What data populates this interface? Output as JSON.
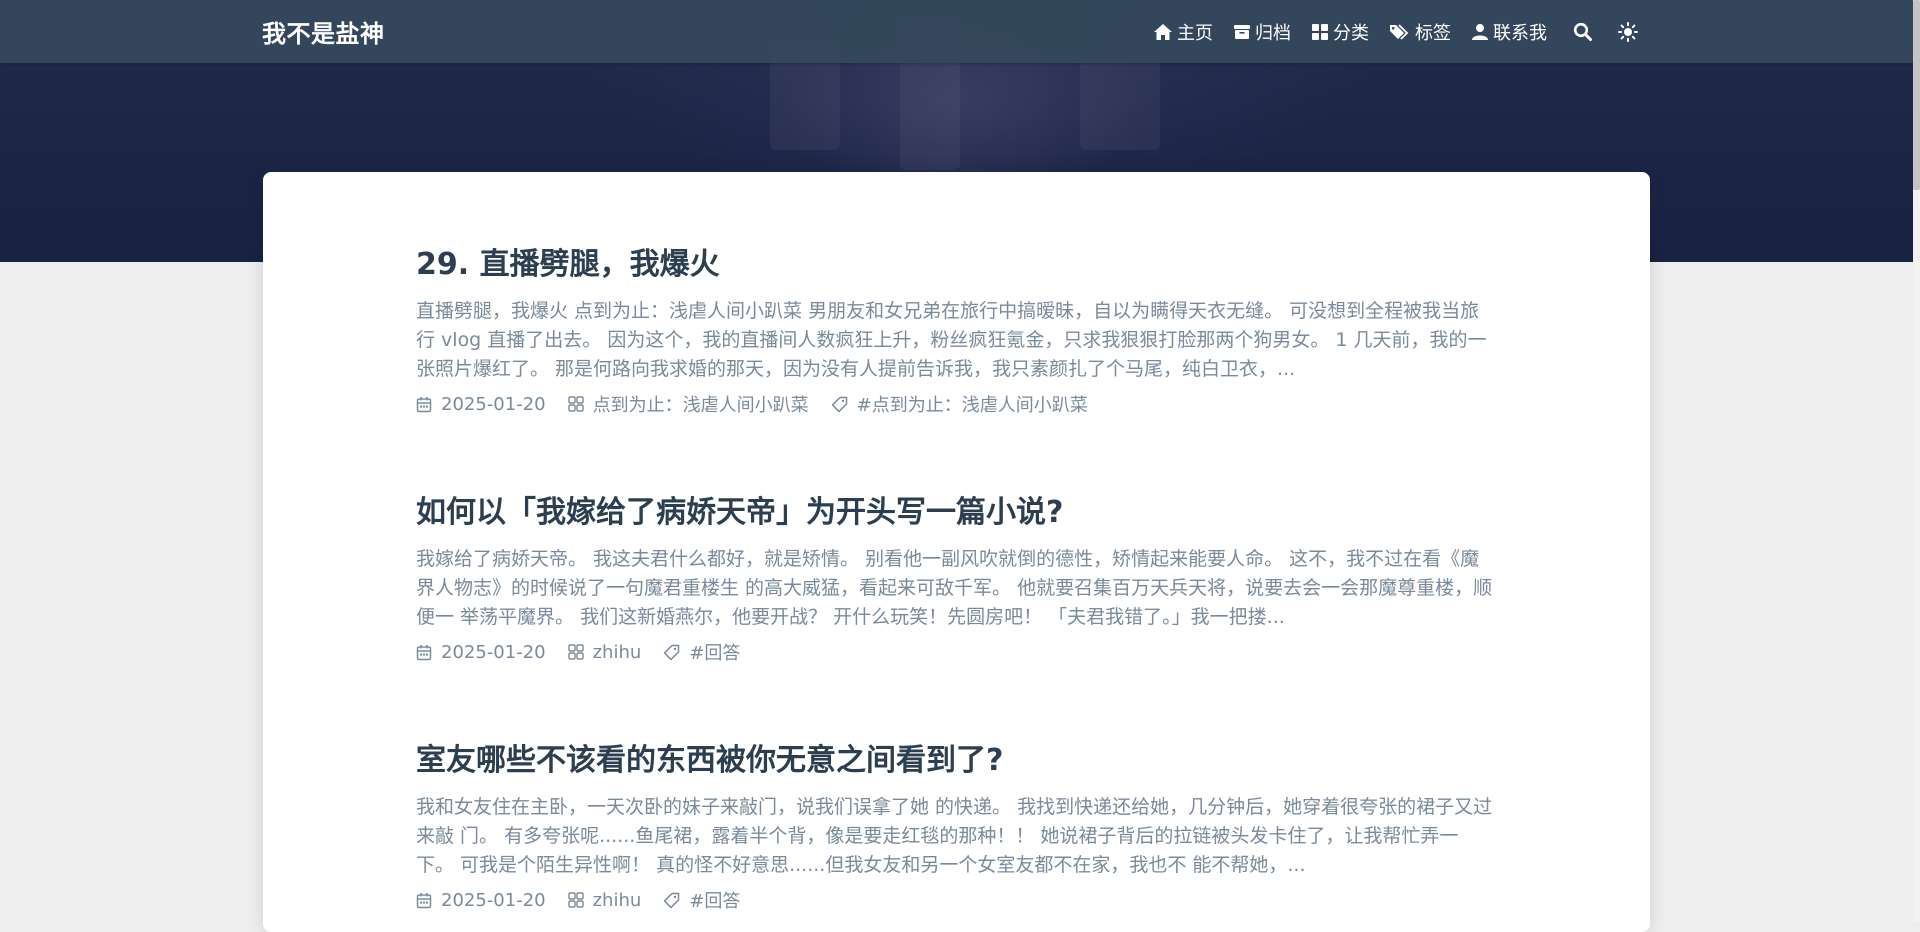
{
  "site": {
    "brand": "我不是盐神"
  },
  "nav": {
    "home": "主页",
    "archive": "归档",
    "categories": "分类",
    "tags": "标签",
    "contact": "联系我"
  },
  "posts": [
    {
      "title": "29. 直播劈腿，我爆火",
      "excerpt": "直播劈腿，我爆火 点到为止：浅虐人间小趴菜 男朋友和女兄弟在旅行中搞暧昧，自以为瞒得天衣无缝。 可没想到全程被我当旅行 vlog 直播了出去。 因为这个，我的直播间人数疯狂上升，粉丝疯狂氪金，只求我狠狠打脸那两个狗男女。 1 几天前，我的一张照片爆红了。 那是何路向我求婚的那天，因为没有人提前告诉我，我只素颜扎了个马尾，纯白卫衣，...",
      "date": "2025-01-20",
      "category": "点到为止：浅虐人间小趴菜",
      "tag": "#点到为止：浅虐人间小趴菜"
    },
    {
      "title": "如何以「我嫁给了病娇天帝」为开头写一篇小说?",
      "excerpt": "我嫁给了病娇天帝。 我这夫君什么都好，就是矫情。 别看他一副风吹就倒的德性，矫情起来能要人命。 这不，我不过在看《魔界人物志》的时候说了一句魔君重楼生 的高大威猛，看起来可敌千军。 他就要召集百万天兵天将，说要去会一会那魔尊重楼，顺便一 举荡平魔界。 我们这新婚燕尔，他要开战？ 开什么玩笑！先圆房吧！ 「夫君我错了。」我一把搂...",
      "date": "2025-01-20",
      "category": "zhihu",
      "tag": "#回答"
    },
    {
      "title": "室友哪些不该看的东西被你无意之间看到了?",
      "excerpt": "我和女友住在主卧，一天次卧的妹子来敲门，说我们误拿了她 的快递。 我找到快递还给她，几分钟后，她穿着很夸张的裙子又过来敲 门。 有多夸张呢......鱼尾裙，露着半个背，像是要走红毯的那种！！ 她说裙子背后的拉链被头发卡住了，让我帮忙弄一下。 可我是个陌生异性啊！ 真的怪不好意思......但我女友和另一个女室友都不在家，我也不 能不帮她，...",
      "date": "2025-01-20",
      "category": "zhihu",
      "tag": "#回答"
    }
  ]
}
